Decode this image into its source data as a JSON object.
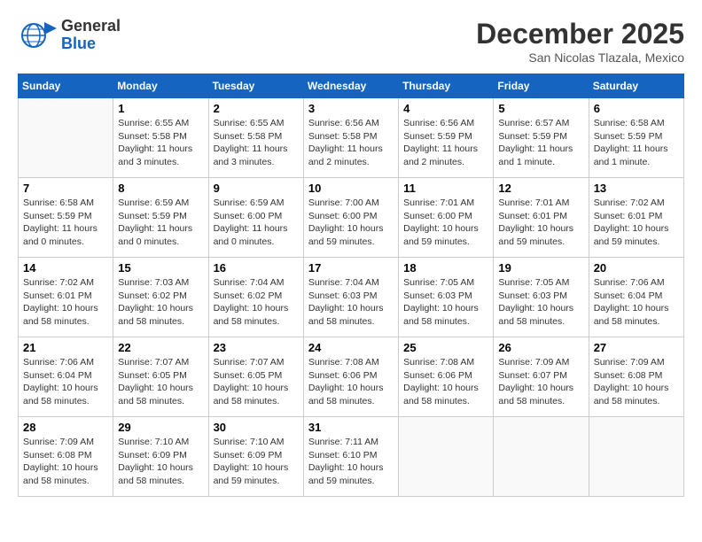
{
  "header": {
    "logo_general": "General",
    "logo_blue": "Blue",
    "month_title": "December 2025",
    "location": "San Nicolas Tlazala, Mexico"
  },
  "weekdays": [
    "Sunday",
    "Monday",
    "Tuesday",
    "Wednesday",
    "Thursday",
    "Friday",
    "Saturday"
  ],
  "weeks": [
    [
      {
        "day": "",
        "info": ""
      },
      {
        "day": "1",
        "info": "Sunrise: 6:55 AM\nSunset: 5:58 PM\nDaylight: 11 hours\nand 3 minutes."
      },
      {
        "day": "2",
        "info": "Sunrise: 6:55 AM\nSunset: 5:58 PM\nDaylight: 11 hours\nand 3 minutes."
      },
      {
        "day": "3",
        "info": "Sunrise: 6:56 AM\nSunset: 5:58 PM\nDaylight: 11 hours\nand 2 minutes."
      },
      {
        "day": "4",
        "info": "Sunrise: 6:56 AM\nSunset: 5:59 PM\nDaylight: 11 hours\nand 2 minutes."
      },
      {
        "day": "5",
        "info": "Sunrise: 6:57 AM\nSunset: 5:59 PM\nDaylight: 11 hours\nand 1 minute."
      },
      {
        "day": "6",
        "info": "Sunrise: 6:58 AM\nSunset: 5:59 PM\nDaylight: 11 hours\nand 1 minute."
      }
    ],
    [
      {
        "day": "7",
        "info": "Sunrise: 6:58 AM\nSunset: 5:59 PM\nDaylight: 11 hours\nand 0 minutes."
      },
      {
        "day": "8",
        "info": "Sunrise: 6:59 AM\nSunset: 5:59 PM\nDaylight: 11 hours\nand 0 minutes."
      },
      {
        "day": "9",
        "info": "Sunrise: 6:59 AM\nSunset: 6:00 PM\nDaylight: 11 hours\nand 0 minutes."
      },
      {
        "day": "10",
        "info": "Sunrise: 7:00 AM\nSunset: 6:00 PM\nDaylight: 10 hours\nand 59 minutes."
      },
      {
        "day": "11",
        "info": "Sunrise: 7:01 AM\nSunset: 6:00 PM\nDaylight: 10 hours\nand 59 minutes."
      },
      {
        "day": "12",
        "info": "Sunrise: 7:01 AM\nSunset: 6:01 PM\nDaylight: 10 hours\nand 59 minutes."
      },
      {
        "day": "13",
        "info": "Sunrise: 7:02 AM\nSunset: 6:01 PM\nDaylight: 10 hours\nand 59 minutes."
      }
    ],
    [
      {
        "day": "14",
        "info": "Sunrise: 7:02 AM\nSunset: 6:01 PM\nDaylight: 10 hours\nand 58 minutes."
      },
      {
        "day": "15",
        "info": "Sunrise: 7:03 AM\nSunset: 6:02 PM\nDaylight: 10 hours\nand 58 minutes."
      },
      {
        "day": "16",
        "info": "Sunrise: 7:04 AM\nSunset: 6:02 PM\nDaylight: 10 hours\nand 58 minutes."
      },
      {
        "day": "17",
        "info": "Sunrise: 7:04 AM\nSunset: 6:03 PM\nDaylight: 10 hours\nand 58 minutes."
      },
      {
        "day": "18",
        "info": "Sunrise: 7:05 AM\nSunset: 6:03 PM\nDaylight: 10 hours\nand 58 minutes."
      },
      {
        "day": "19",
        "info": "Sunrise: 7:05 AM\nSunset: 6:03 PM\nDaylight: 10 hours\nand 58 minutes."
      },
      {
        "day": "20",
        "info": "Sunrise: 7:06 AM\nSunset: 6:04 PM\nDaylight: 10 hours\nand 58 minutes."
      }
    ],
    [
      {
        "day": "21",
        "info": "Sunrise: 7:06 AM\nSunset: 6:04 PM\nDaylight: 10 hours\nand 58 minutes."
      },
      {
        "day": "22",
        "info": "Sunrise: 7:07 AM\nSunset: 6:05 PM\nDaylight: 10 hours\nand 58 minutes."
      },
      {
        "day": "23",
        "info": "Sunrise: 7:07 AM\nSunset: 6:05 PM\nDaylight: 10 hours\nand 58 minutes."
      },
      {
        "day": "24",
        "info": "Sunrise: 7:08 AM\nSunset: 6:06 PM\nDaylight: 10 hours\nand 58 minutes."
      },
      {
        "day": "25",
        "info": "Sunrise: 7:08 AM\nSunset: 6:06 PM\nDaylight: 10 hours\nand 58 minutes."
      },
      {
        "day": "26",
        "info": "Sunrise: 7:09 AM\nSunset: 6:07 PM\nDaylight: 10 hours\nand 58 minutes."
      },
      {
        "day": "27",
        "info": "Sunrise: 7:09 AM\nSunset: 6:08 PM\nDaylight: 10 hours\nand 58 minutes."
      }
    ],
    [
      {
        "day": "28",
        "info": "Sunrise: 7:09 AM\nSunset: 6:08 PM\nDaylight: 10 hours\nand 58 minutes."
      },
      {
        "day": "29",
        "info": "Sunrise: 7:10 AM\nSunset: 6:09 PM\nDaylight: 10 hours\nand 58 minutes."
      },
      {
        "day": "30",
        "info": "Sunrise: 7:10 AM\nSunset: 6:09 PM\nDaylight: 10 hours\nand 59 minutes."
      },
      {
        "day": "31",
        "info": "Sunrise: 7:11 AM\nSunset: 6:10 PM\nDaylight: 10 hours\nand 59 minutes."
      },
      {
        "day": "",
        "info": ""
      },
      {
        "day": "",
        "info": ""
      },
      {
        "day": "",
        "info": ""
      }
    ]
  ]
}
